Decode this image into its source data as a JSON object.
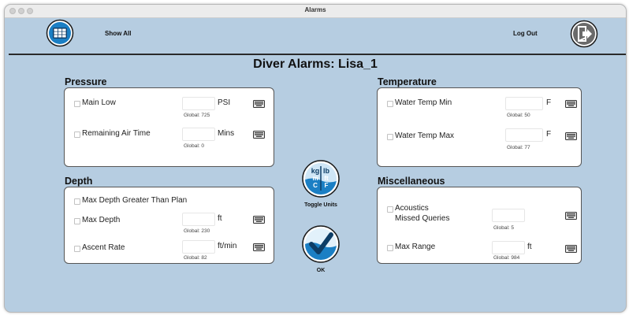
{
  "window": {
    "title": "Alarms"
  },
  "header": {
    "show_all_label": "Show All",
    "log_out_label": "Log Out"
  },
  "main_title": "Diver Alarms: Lisa_1",
  "pressure": {
    "title": "Pressure",
    "rows": [
      {
        "label": "Main Low",
        "value": "",
        "unit": "PSI",
        "global": "Global: 725"
      },
      {
        "label": "Remaining Air Time",
        "value": "",
        "unit": "Mins",
        "global": "Global: 0"
      }
    ]
  },
  "depth": {
    "title": "Depth",
    "plan_label": "Max Depth Greater Than Plan",
    "rows": [
      {
        "label": "Max Depth",
        "value": "",
        "unit": "ft",
        "global": "Global: 230"
      },
      {
        "label": "Ascent Rate",
        "value": "",
        "unit": "ft/min",
        "global": "Global: 82"
      }
    ]
  },
  "temperature": {
    "title": "Temperature",
    "rows": [
      {
        "label": "Water Temp Min",
        "value": "",
        "unit": "F",
        "global": "Global: 50"
      },
      {
        "label": "Water Temp Max",
        "value": "",
        "unit": "F",
        "global": "Global: 77"
      }
    ]
  },
  "misc": {
    "title": "Miscellaneous",
    "acoustics": {
      "label_line1": "Acoustics",
      "label_line2": "Missed Queries",
      "value": "",
      "global": "Global: 5"
    },
    "max_range": {
      "label": "Max Range",
      "value": "",
      "unit": "ft",
      "global": "Global: 984"
    }
  },
  "toggle": {
    "label": "Toggle Units",
    "glyphs": {
      "kg": "kg",
      "lb": "lb",
      "m": "m",
      "ft": "ft",
      "c": "C",
      "f": "F"
    }
  },
  "ok": {
    "label": "OK"
  },
  "icons": {
    "grid": "grid-icon",
    "logout": "logout-icon",
    "keyboard": "keyboard-icon",
    "toggle": "toggle-units-icon",
    "checkmark": "checkmark-icon"
  },
  "colors": {
    "background": "#b6cde1",
    "accent_blue": "#1b7fc4",
    "panel": "#ffffff",
    "title_bar": "#ececec"
  }
}
